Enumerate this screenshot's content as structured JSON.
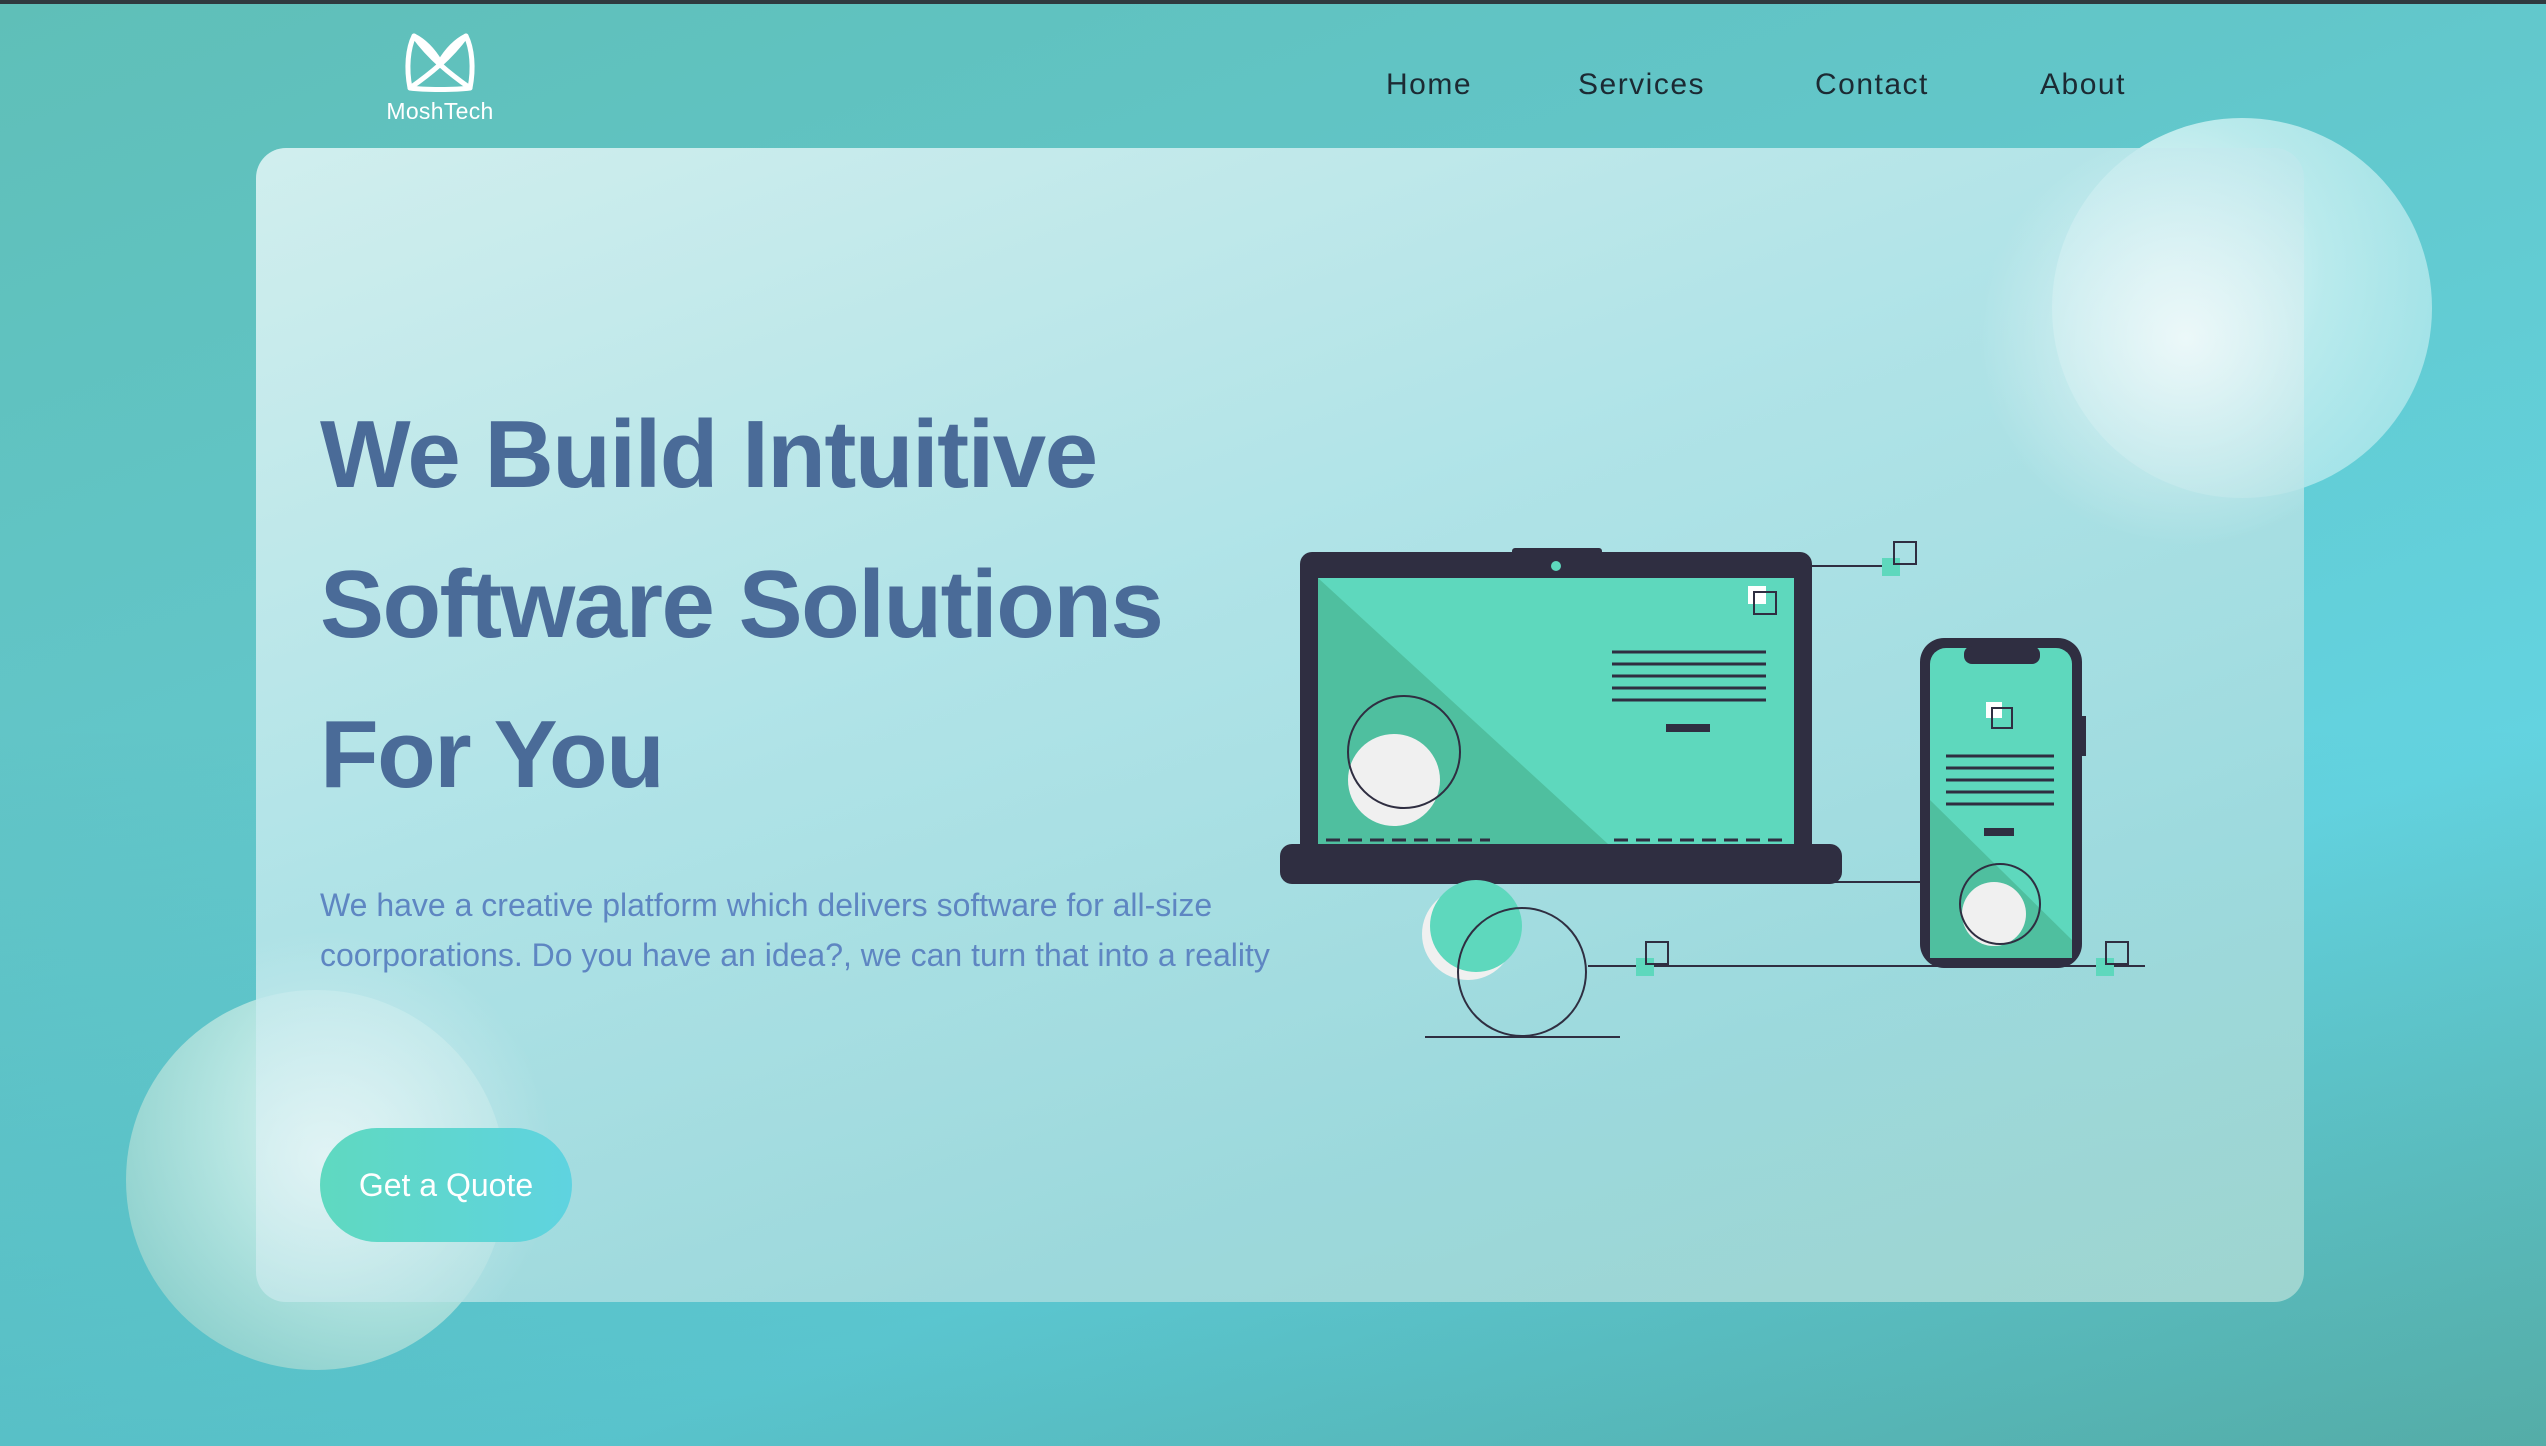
{
  "brand": {
    "name": "MoshTech"
  },
  "nav": {
    "items": [
      {
        "label": "Home"
      },
      {
        "label": "Services"
      },
      {
        "label": "Contact"
      },
      {
        "label": "About"
      }
    ]
  },
  "hero": {
    "headline_lines": [
      "We Build Intuitive",
      "Software Solutions",
      "For You"
    ],
    "description": "We have a creative platform which delivers software for all-size coorporations. Do you have an idea?, we can turn that into a reality",
    "cta_label": "Get a Quote"
  },
  "illustration": {
    "icons": [
      "laptop-icon",
      "smartphone-icon"
    ]
  },
  "colors": {
    "headline": "#4a6b98",
    "description": "#5e86c2",
    "accent_green": "#5ed8bd",
    "device_dark": "#2f2e41",
    "nav_text": "#1c2a33"
  }
}
